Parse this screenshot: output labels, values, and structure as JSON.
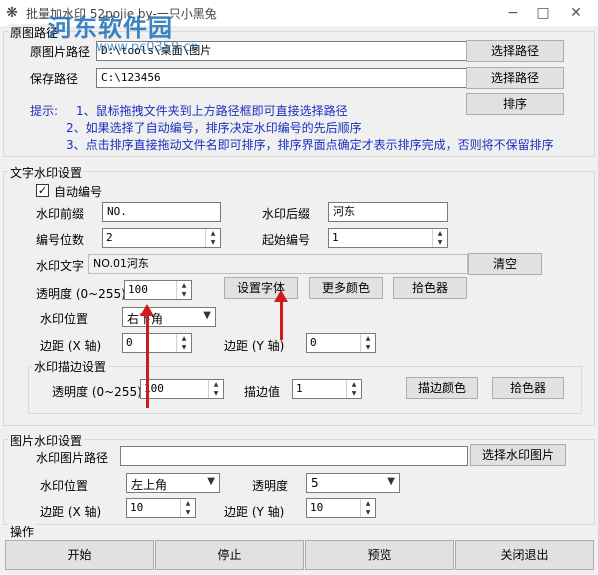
{
  "window": {
    "title": "批量加水印 52pojie by-一只小黑兔",
    "watermark_logo": "河东软件园",
    "watermark_url": "www.pc0359.cn",
    "minimize": "−",
    "maximize": "□",
    "close": "✕"
  },
  "paths": {
    "group_title": "原图路径",
    "source_label": "原图片路径",
    "source_value": "D:\\tools\\桌面\\图片",
    "source_button": "选择路径",
    "save_label": "保存路径",
    "save_value": "C:\\123456",
    "save_button": "选择路径",
    "sort_button": "排序",
    "hint_label": "提示:",
    "hints": [
      "1、鼠标拖拽文件夹到上方路径框即可直接选择路径",
      "2、如果选择了自动编号，排序决定水印编号的先后顺序",
      "3、点击排序直接拖动文件名即可排序，排序界面点确定才表示排序完成，否则将不保留排序"
    ]
  },
  "text_wm": {
    "group_title": "文字水印设置",
    "auto_number_label": "自动编号",
    "auto_number_checked": true,
    "prefix_label": "水印前缀",
    "prefix_value": "NO.",
    "suffix_label": "水印后缀",
    "suffix_value": "河东",
    "digits_label": "编号位数",
    "digits_value": "2",
    "start_label": "起始编号",
    "start_value": "1",
    "text_label": "水印文字",
    "text_value": "NO.01河东",
    "clear_button": "清空",
    "opacity_label": "透明度 (0~255)",
    "opacity_value": "100",
    "font_button": "设置字体",
    "colors_button": "更多颜色",
    "picker_button": "拾色器",
    "position_label": "水印位置",
    "position_value": "右下角",
    "margin_x_label": "边距 (X 轴)",
    "margin_x_value": "0",
    "margin_y_label": "边距 (Y 轴)",
    "margin_y_value": "0",
    "stroke_title": "水印描边设置",
    "stroke_opacity_label": "透明度 (0~255)",
    "stroke_opacity_value": "100",
    "stroke_value_label": "描边值",
    "stroke_value": "1",
    "stroke_color_button": "描边颜色",
    "stroke_picker_button": "拾色器"
  },
  "image_wm": {
    "group_title": "图片水印设置",
    "path_label": "水印图片路径",
    "path_value": "",
    "select_button": "选择水印图片",
    "position_label": "水印位置",
    "position_value": "左上角",
    "opacity_label": "透明度",
    "opacity_value": "5",
    "margin_x_label": "边距 (X 轴)",
    "margin_x_value": "10",
    "margin_y_label": "边距 (Y 轴)",
    "margin_y_value": "10"
  },
  "actions": {
    "group_title": "操作",
    "start": "开始",
    "stop": "停止",
    "preview": "预览",
    "close": "关闭退出"
  },
  "colors": {
    "hint_text": "#1a2fbf",
    "annotation_arrow": "#d11a1a"
  }
}
